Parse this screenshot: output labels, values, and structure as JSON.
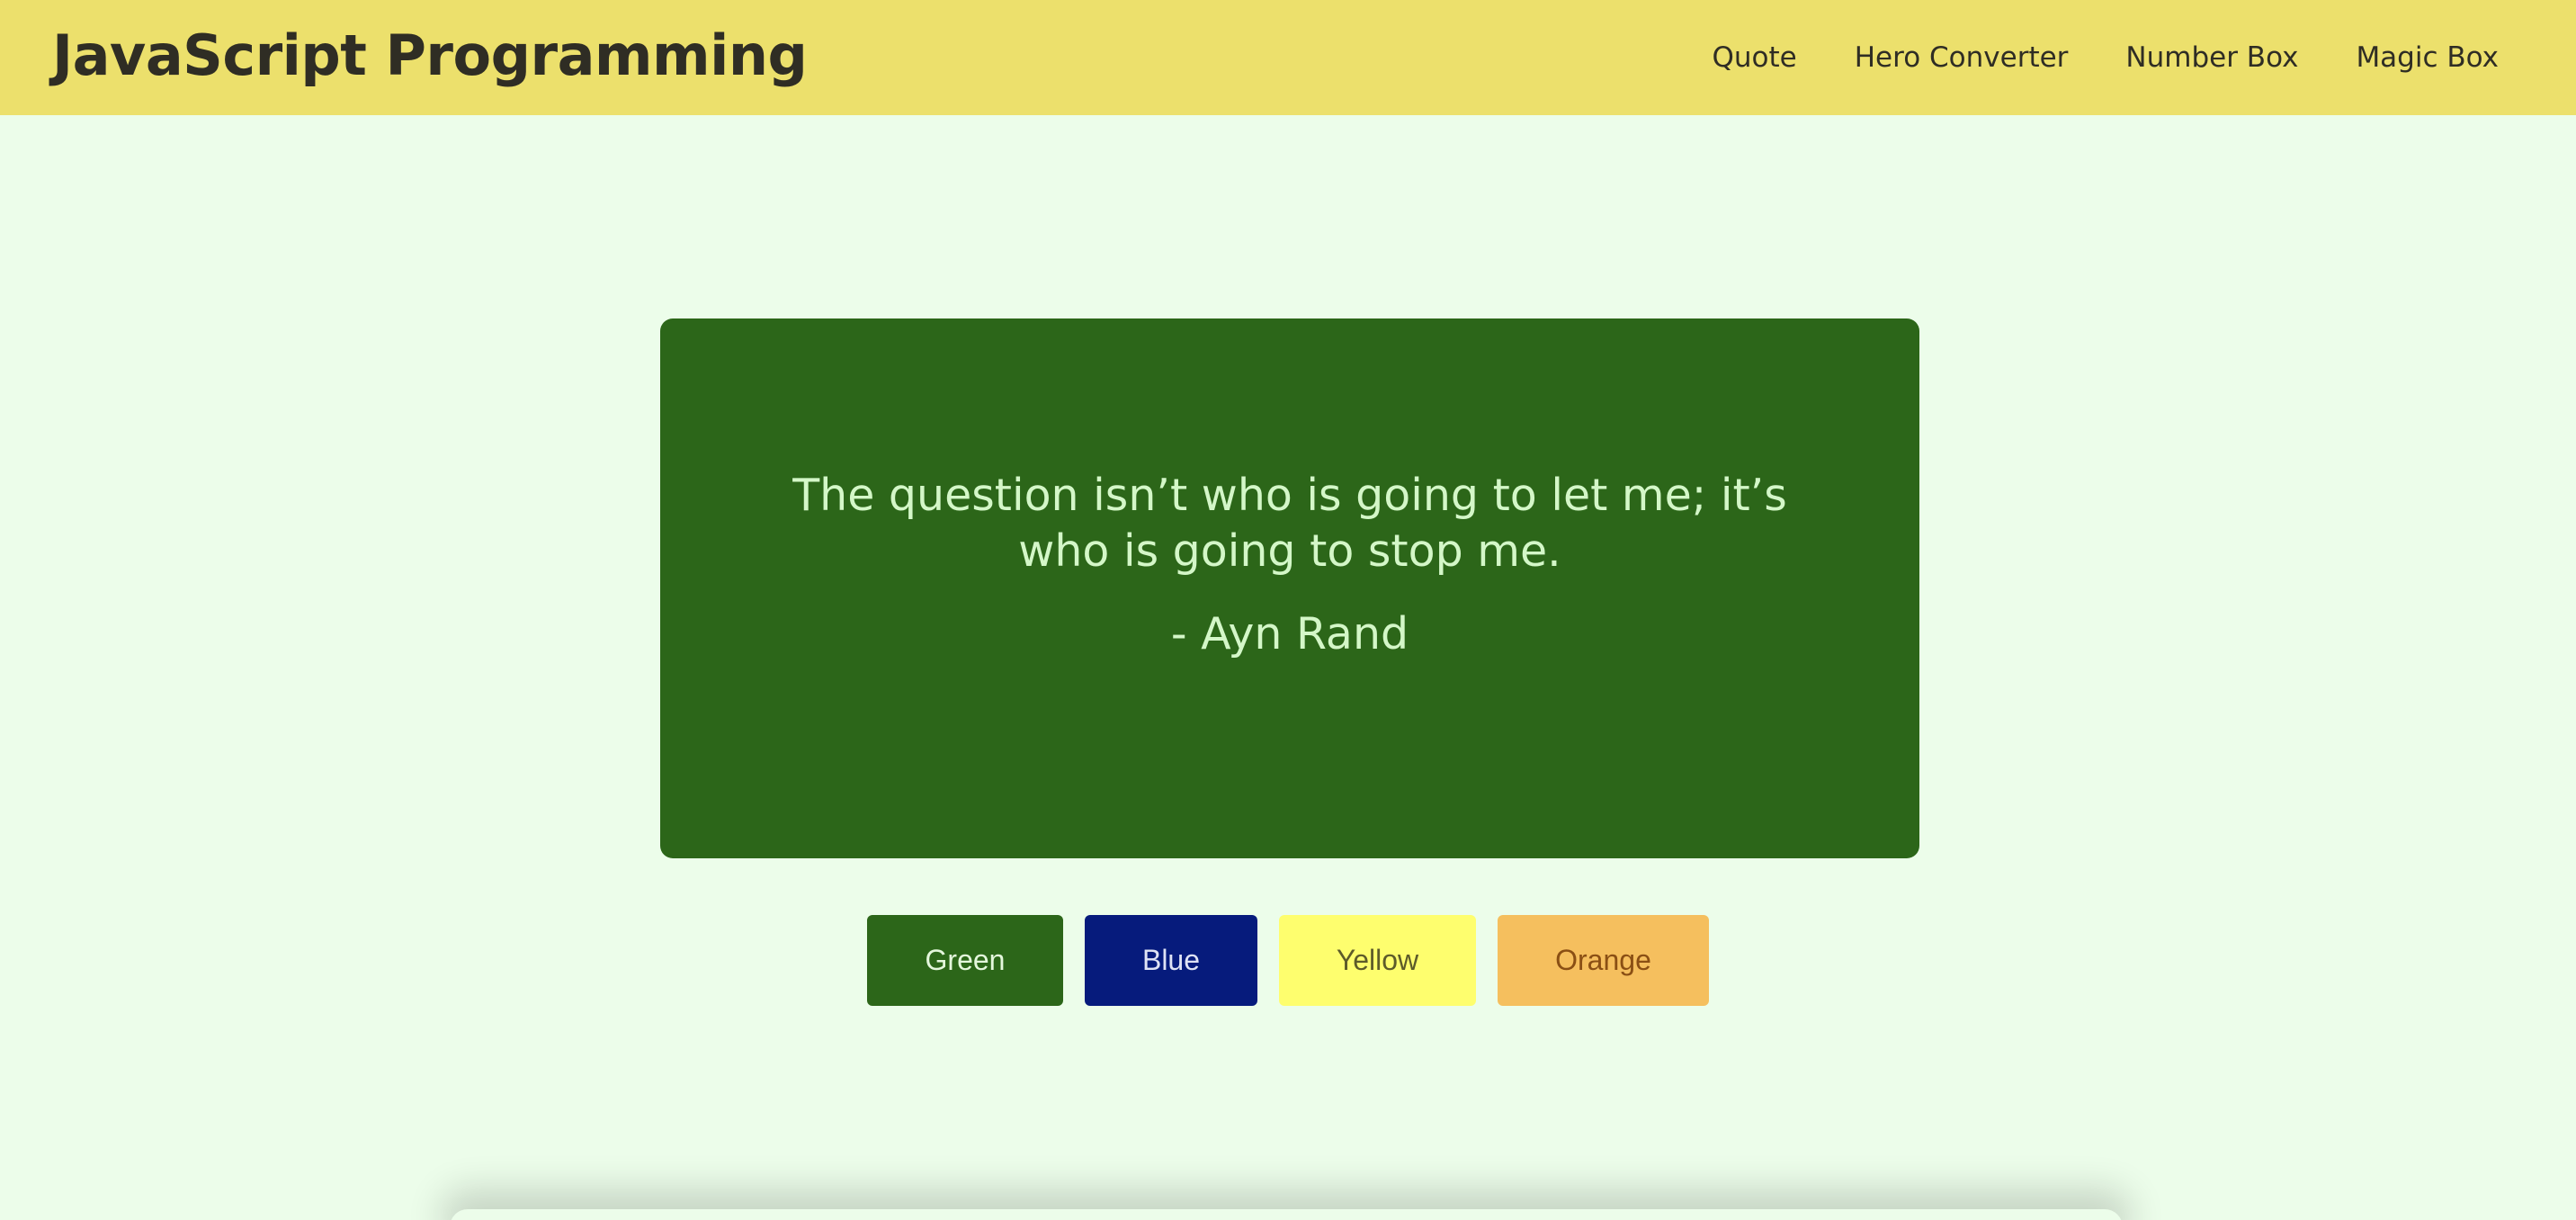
{
  "header": {
    "brand": "JavaScript Programming",
    "nav": [
      {
        "label": "Quote"
      },
      {
        "label": "Hero Converter"
      },
      {
        "label": "Number Box"
      },
      {
        "label": "Magic Box"
      }
    ]
  },
  "quote": {
    "text": "The question isn’t who is going to let me; it’s who is going to stop me.",
    "author": "- Ayn Rand",
    "background_color": "#2c6619"
  },
  "color_buttons": [
    {
      "label": "Green",
      "color": "#2c6619"
    },
    {
      "label": "Blue",
      "color": "#061b7c"
    },
    {
      "label": "Yellow",
      "color": "#fefe6e"
    },
    {
      "label": "Orange",
      "color": "#f5bf5e"
    }
  ],
  "colors": {
    "page_background": "#ecfdea",
    "header_background": "#ece06c"
  }
}
